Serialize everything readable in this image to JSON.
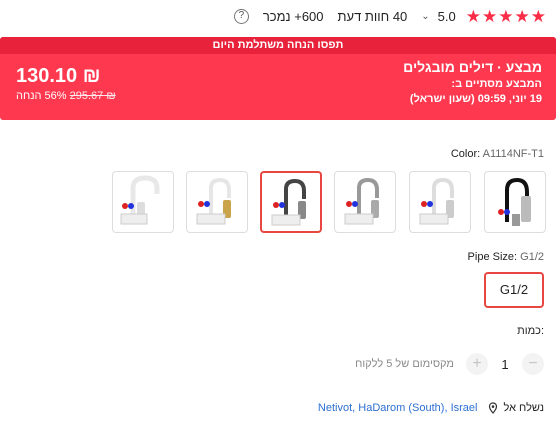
{
  "rating": {
    "stars": 5,
    "value": "5.0",
    "chevron": "⌄",
    "reviews": "40 חוות דעת",
    "sold": "600+ נמכר",
    "help_icon": "?"
  },
  "banner": {
    "top_text": "תפסו הנחה משתלמת היום",
    "deal_title": "מבצע · דילים מובגלים",
    "ends_label": "המבצע מסתיים ב:",
    "ends_time": "19 יוני, 09:59 (שעון ישראל)",
    "price": "₪ 130.10",
    "old_price": "₪ 295.67",
    "discount": "56% הנחה"
  },
  "color": {
    "label": "Color:",
    "value": "A1114NF-T1",
    "selected_index": 3,
    "swatches": [
      "black-flexible-faucet",
      "white-faucet",
      "chrome-faucet",
      "black-gray-faucet",
      "gold-white-faucet",
      "white-curved-faucet"
    ]
  },
  "pipe": {
    "label": "Pipe Size:",
    "value": "G1/2",
    "option": "G1/2"
  },
  "quantity": {
    "label": "כמות:",
    "minus": "−",
    "value": "1",
    "plus": "+",
    "max_text": "מקסימום של 5 ללקוח"
  },
  "shipping": {
    "label": "נשלח אל",
    "location": "Netivot, HaDarom (South), Israel"
  },
  "colors": {
    "accent": "#fd384f",
    "accent_dark": "#e8223a",
    "selected_border": "#e8473f",
    "link": "#2d6fd1"
  }
}
